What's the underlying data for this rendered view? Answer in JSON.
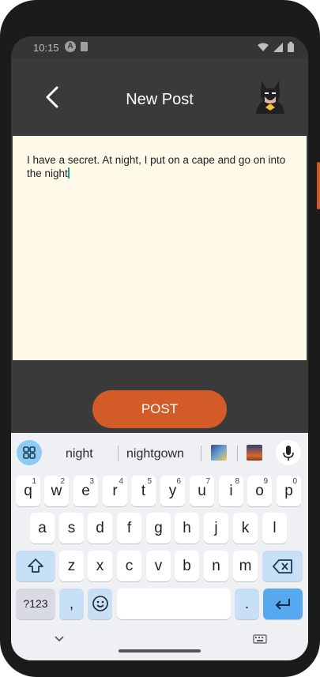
{
  "status": {
    "time": "10:15",
    "a_badge": "A"
  },
  "appbar": {
    "title": "New Post"
  },
  "post": {
    "text": "I have a secret. At night, I put on a cape and go on into the night"
  },
  "actions": {
    "post_label": "POST"
  },
  "keyboard": {
    "suggestions": [
      "night",
      "nightgown"
    ],
    "row1": [
      {
        "key": "q",
        "hint": "1"
      },
      {
        "key": "w",
        "hint": "2"
      },
      {
        "key": "e",
        "hint": "3"
      },
      {
        "key": "r",
        "hint": "4"
      },
      {
        "key": "t",
        "hint": "5"
      },
      {
        "key": "y",
        "hint": "6"
      },
      {
        "key": "u",
        "hint": "7"
      },
      {
        "key": "i",
        "hint": "8"
      },
      {
        "key": "o",
        "hint": "9"
      },
      {
        "key": "p",
        "hint": "0"
      }
    ],
    "row2": [
      "a",
      "s",
      "d",
      "f",
      "g",
      "h",
      "j",
      "k",
      "l"
    ],
    "row3": [
      "z",
      "x",
      "c",
      "v",
      "b",
      "n",
      "m"
    ],
    "symbols_label": "?123",
    "comma": ",",
    "period": "."
  },
  "colors": {
    "accent": "#d35b28",
    "appbar": "#3a3a3a",
    "post_bg": "#fff9ea",
    "keyboard_bg": "#eef0f4",
    "key_blue": "#c8e0f6"
  }
}
